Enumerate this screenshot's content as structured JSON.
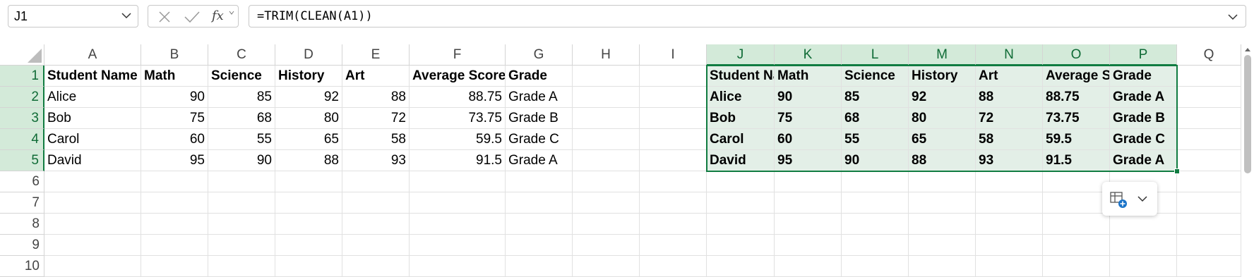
{
  "formula_bar": {
    "name_box": "J1",
    "formula": "=TRIM(CLEAN(A1))",
    "fx_label": "fx"
  },
  "columns": [
    "A",
    "B",
    "C",
    "D",
    "E",
    "F",
    "G",
    "H",
    "I",
    "J",
    "K",
    "L",
    "M",
    "N",
    "O",
    "P",
    "Q"
  ],
  "rows": [
    "1",
    "2",
    "3",
    "4",
    "5",
    "6",
    "7",
    "8",
    "9",
    "10"
  ],
  "source_table": {
    "headers": [
      "Student Name",
      "Math",
      "Science",
      "History",
      "Art",
      "Average Score",
      "Grade"
    ],
    "rows": [
      [
        " Alice",
        "90",
        "85",
        "92",
        "88",
        "88.75",
        "Grade A"
      ],
      [
        "Bob",
        "75",
        "68",
        "80",
        "72",
        "73.75",
        "Grade B"
      ],
      [
        " Carol",
        "60",
        "55",
        "65",
        "58",
        "59.5",
        "Grade C"
      ],
      [
        "David",
        "95",
        "90",
        "88",
        "93",
        "91.5",
        "Grade A"
      ]
    ]
  },
  "result_table": {
    "headers": [
      "Student Na",
      "Math",
      "Science",
      "History",
      "Art",
      "Average Sc",
      "Grade"
    ],
    "rows": [
      [
        "Alice",
        "90",
        "85",
        "92",
        "88",
        "88.75",
        "Grade A"
      ],
      [
        "Bob",
        "75",
        "68",
        "80",
        "72",
        "73.75",
        "Grade B"
      ],
      [
        "Carol",
        "60",
        "55",
        "65",
        "58",
        "59.5",
        "Grade C"
      ],
      [
        "David",
        "95",
        "90",
        "88",
        "93",
        "91.5",
        "Grade A"
      ]
    ]
  },
  "colors": {
    "accent": "#107c41",
    "selection_fill": "#e3efe7",
    "header_selected": "#d3ead9"
  },
  "icons": {
    "quick_analysis": "table-plus-icon",
    "name_box_chevron": "chevron-down-icon",
    "cancel": "close-icon",
    "enter": "check-icon"
  }
}
